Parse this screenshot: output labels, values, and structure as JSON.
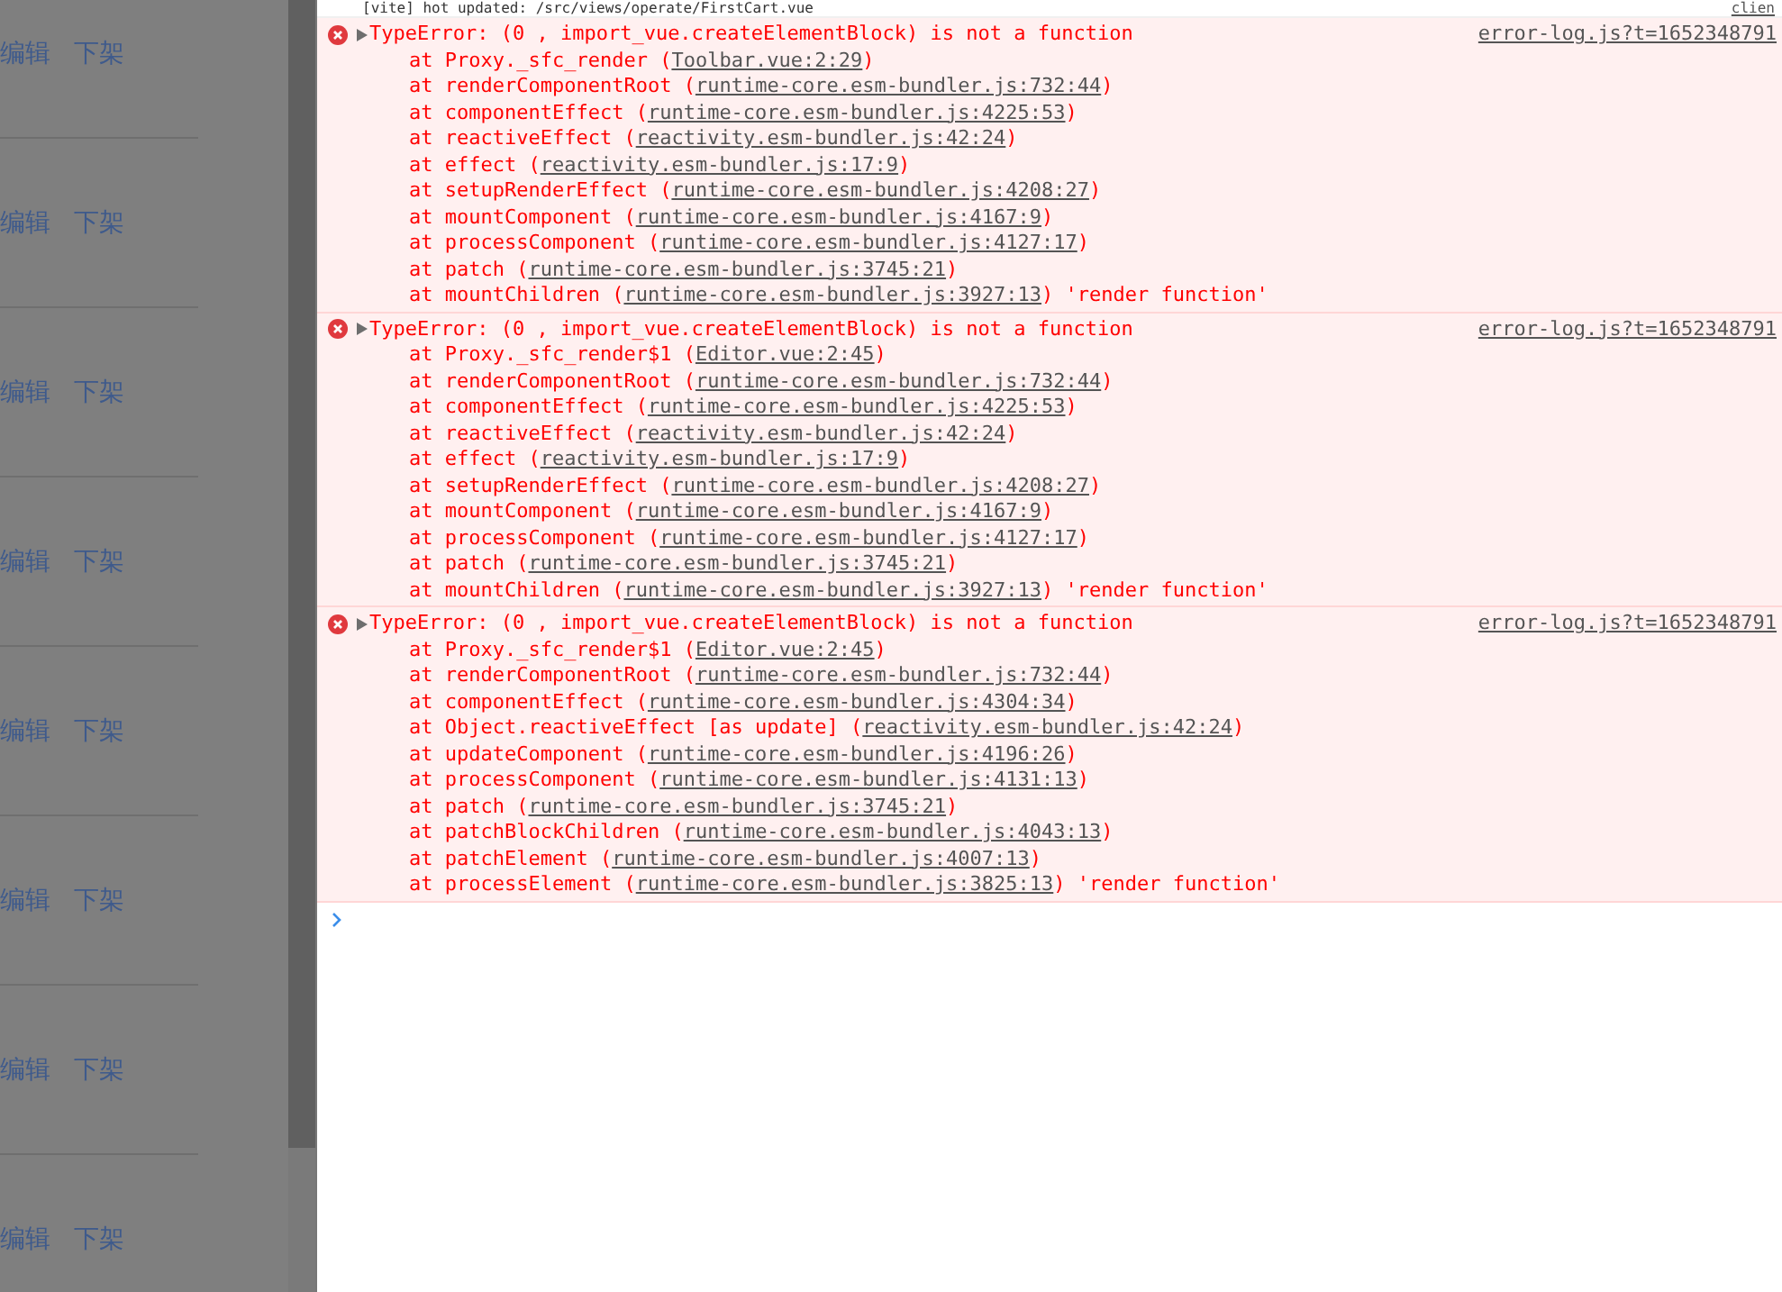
{
  "list": {
    "rows": [
      {
        "actions": [
          "编辑",
          "下架"
        ]
      },
      {
        "actions": [
          "编辑",
          "下架"
        ]
      },
      {
        "actions": [
          "编辑",
          "下架"
        ]
      },
      {
        "actions": [
          "编辑",
          "下架"
        ]
      },
      {
        "actions": [
          "编辑",
          "下架"
        ]
      },
      {
        "actions": [
          "编辑",
          "下架"
        ]
      },
      {
        "actions": [
          "编辑",
          "下架"
        ]
      },
      {
        "actions": [
          "编辑",
          "下架"
        ]
      }
    ]
  },
  "console": {
    "top_message": "[vite] hot updated: /src/views/operate/FirstCart.vue",
    "top_source": "clien",
    "errors": [
      {
        "message": "TypeError: (0 , import_vue.createElementBlock) is not a function",
        "source": "error-log.js?t=1652348791",
        "expanded": false,
        "stack": [
          {
            "text": "at Proxy._sfc_render (",
            "location": "Toolbar.vue:2:29",
            "suffix": ")"
          },
          {
            "text": "at renderComponentRoot (",
            "location": "runtime-core.esm-bundler.js:732:44",
            "suffix": ")"
          },
          {
            "text": "at componentEffect (",
            "location": "runtime-core.esm-bundler.js:4225:53",
            "suffix": ")"
          },
          {
            "text": "at reactiveEffect (",
            "location": "reactivity.esm-bundler.js:42:24",
            "suffix": ")"
          },
          {
            "text": "at effect (",
            "location": "reactivity.esm-bundler.js:17:9",
            "suffix": ")"
          },
          {
            "text": "at setupRenderEffect (",
            "location": "runtime-core.esm-bundler.js:4208:27",
            "suffix": ")"
          },
          {
            "text": "at mountComponent (",
            "location": "runtime-core.esm-bundler.js:4167:9",
            "suffix": ")"
          },
          {
            "text": "at processComponent (",
            "location": "runtime-core.esm-bundler.js:4127:17",
            "suffix": ")"
          },
          {
            "text": "at patch (",
            "location": "runtime-core.esm-bundler.js:3745:21",
            "suffix": ")"
          },
          {
            "text": "at mountChildren (",
            "location": "runtime-core.esm-bundler.js:3927:13",
            "suffix": ") 'render function'"
          }
        ]
      },
      {
        "message": "TypeError: (0 , import_vue.createElementBlock) is not a function",
        "source": "error-log.js?t=1652348791",
        "expanded": false,
        "stack": [
          {
            "text": "at Proxy._sfc_render$1 (",
            "location": "Editor.vue:2:45",
            "suffix": ")"
          },
          {
            "text": "at renderComponentRoot (",
            "location": "runtime-core.esm-bundler.js:732:44",
            "suffix": ")"
          },
          {
            "text": "at componentEffect (",
            "location": "runtime-core.esm-bundler.js:4225:53",
            "suffix": ")"
          },
          {
            "text": "at reactiveEffect (",
            "location": "reactivity.esm-bundler.js:42:24",
            "suffix": ")"
          },
          {
            "text": "at effect (",
            "location": "reactivity.esm-bundler.js:17:9",
            "suffix": ")"
          },
          {
            "text": "at setupRenderEffect (",
            "location": "runtime-core.esm-bundler.js:4208:27",
            "suffix": ")"
          },
          {
            "text": "at mountComponent (",
            "location": "runtime-core.esm-bundler.js:4167:9",
            "suffix": ")"
          },
          {
            "text": "at processComponent (",
            "location": "runtime-core.esm-bundler.js:4127:17",
            "suffix": ")"
          },
          {
            "text": "at patch (",
            "location": "runtime-core.esm-bundler.js:3745:21",
            "suffix": ")"
          },
          {
            "text": "at mountChildren (",
            "location": "runtime-core.esm-bundler.js:3927:13",
            "suffix": ") 'render function'"
          }
        ]
      },
      {
        "message": "TypeError: (0 , import_vue.createElementBlock) is not a function",
        "source": "error-log.js?t=1652348791",
        "expanded": false,
        "stack": [
          {
            "text": "at Proxy._sfc_render$1 (",
            "location": "Editor.vue:2:45",
            "suffix": ")"
          },
          {
            "text": "at renderComponentRoot (",
            "location": "runtime-core.esm-bundler.js:732:44",
            "suffix": ")"
          },
          {
            "text": "at componentEffect (",
            "location": "runtime-core.esm-bundler.js:4304:34",
            "suffix": ")"
          },
          {
            "text": "at Object.reactiveEffect [as update] (",
            "location": "reactivity.esm-bundler.js:42:24",
            "suffix": ")"
          },
          {
            "text": "at updateComponent (",
            "location": "runtime-core.esm-bundler.js:4196:26",
            "suffix": ")"
          },
          {
            "text": "at processComponent (",
            "location": "runtime-core.esm-bundler.js:4131:13",
            "suffix": ")"
          },
          {
            "text": "at patch (",
            "location": "runtime-core.esm-bundler.js:3745:21",
            "suffix": ")"
          },
          {
            "text": "at patchBlockChildren (",
            "location": "runtime-core.esm-bundler.js:4043:13",
            "suffix": ")"
          },
          {
            "text": "at patchElement (",
            "location": "runtime-core.esm-bundler.js:4007:13",
            "suffix": ")"
          },
          {
            "text": "at processElement (",
            "location": "runtime-core.esm-bundler.js:3825:13",
            "suffix": ") 'render function'"
          }
        ]
      }
    ]
  }
}
